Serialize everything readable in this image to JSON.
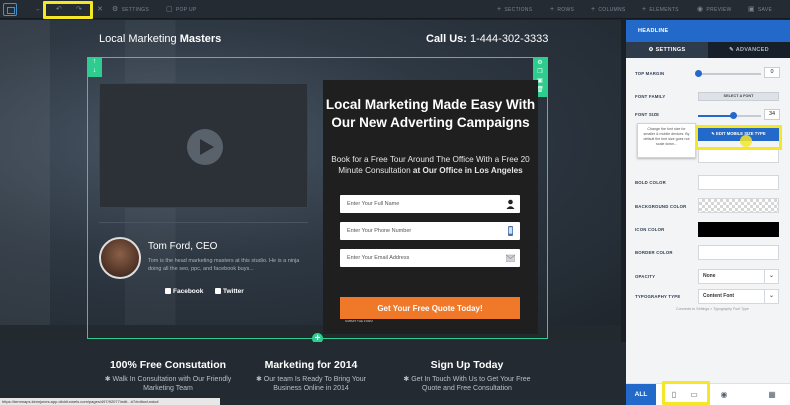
{
  "toolbar": {
    "settings": "SETTINGS",
    "popup": "POP UP",
    "sections": "SECTIONS",
    "rows": "ROWS",
    "columns": "COLUMNS",
    "elements": "ELEMENTS",
    "preview": "PREVIEW",
    "save": "SAVE",
    "undo_icon": "undo-icon",
    "redo_icon": "redo-icon",
    "accent": "#2269c9",
    "highlight": "#f5e626"
  },
  "page": {
    "brand_regular": "Local Marketing ",
    "brand_bold": "Masters",
    "phone_bold": "Call Us:",
    "phone_number": " 1-444-302-3333",
    "person_name": "Tom Ford, CEO",
    "person_bio": "Tom is the head marketing masters at this studio. He is a ninja doing all the seo, ppc, and facebook buys...",
    "facebook": "Facebook",
    "twitter": "Twitter",
    "headline": "Local Marketing Made Easy With Our New Adverting Campaigns",
    "subtext_regular": "Book for a Free Tour Around The Office With a Free 20 Minute Consultation ",
    "subtext_bold": "at Our Office in Los Angeles",
    "fields": {
      "full_name": "Enter Your Full Name",
      "phone": "Enter Your Phone Number",
      "email": "Enter Your Email Address"
    },
    "cta": "Get Your Free Quote Today!",
    "cta_note": "SUBMIT THE FORM",
    "features": [
      {
        "title": "100% Free Consutation",
        "text": "Walk In Consultation with Our Friendly Marketing Team"
      },
      {
        "title": "Marketing for 2014",
        "text": "Our team Is Ready To Bring Your Business Online in 2014"
      },
      {
        "title": "Sign Up Today",
        "text": "Get In Touch With Us to Get Your Free Quote and Free Consultation"
      }
    ],
    "status_url": "https://temmaps.kinmjones.app.clickfunnels.com/pages/497/92077/edit...#7/editor/undo#"
  },
  "panel": {
    "title": "HEADLINE",
    "tab_settings": "SETTINGS",
    "tab_advanced": "ADVANCED",
    "top_margin_label": "TOP MARGIN",
    "top_margin_value": "0",
    "top_margin_fraction": 0.0,
    "font_family_label": "FONT FAMILY",
    "select_font": "SELECT A FONT",
    "font_size_label": "FONT SIZE",
    "font_size_value": "34",
    "font_size_fraction": 0.55,
    "edit_mobile": "EDIT MOBILE SIZE",
    "edit_mobile_suffix": "TYPE",
    "tooltip": "Change the font size for smaller & mobile devices. By default the font size goes not scale down...",
    "bold_color_label": "BOLD COLOR",
    "background_color_label": "BACKGROUND COLOR",
    "icon_color_label": "ICON COLOR",
    "border_color_label": "BORDER COLOR",
    "opacity_label": "OPACITY",
    "opacity_value": "None",
    "typography_type_label": "TYPOGRAPHY TYPE",
    "typography_type_value": "Content Font",
    "connects_note": "Connects to Settings > Typography Font Type",
    "footer_all": "ALL"
  }
}
